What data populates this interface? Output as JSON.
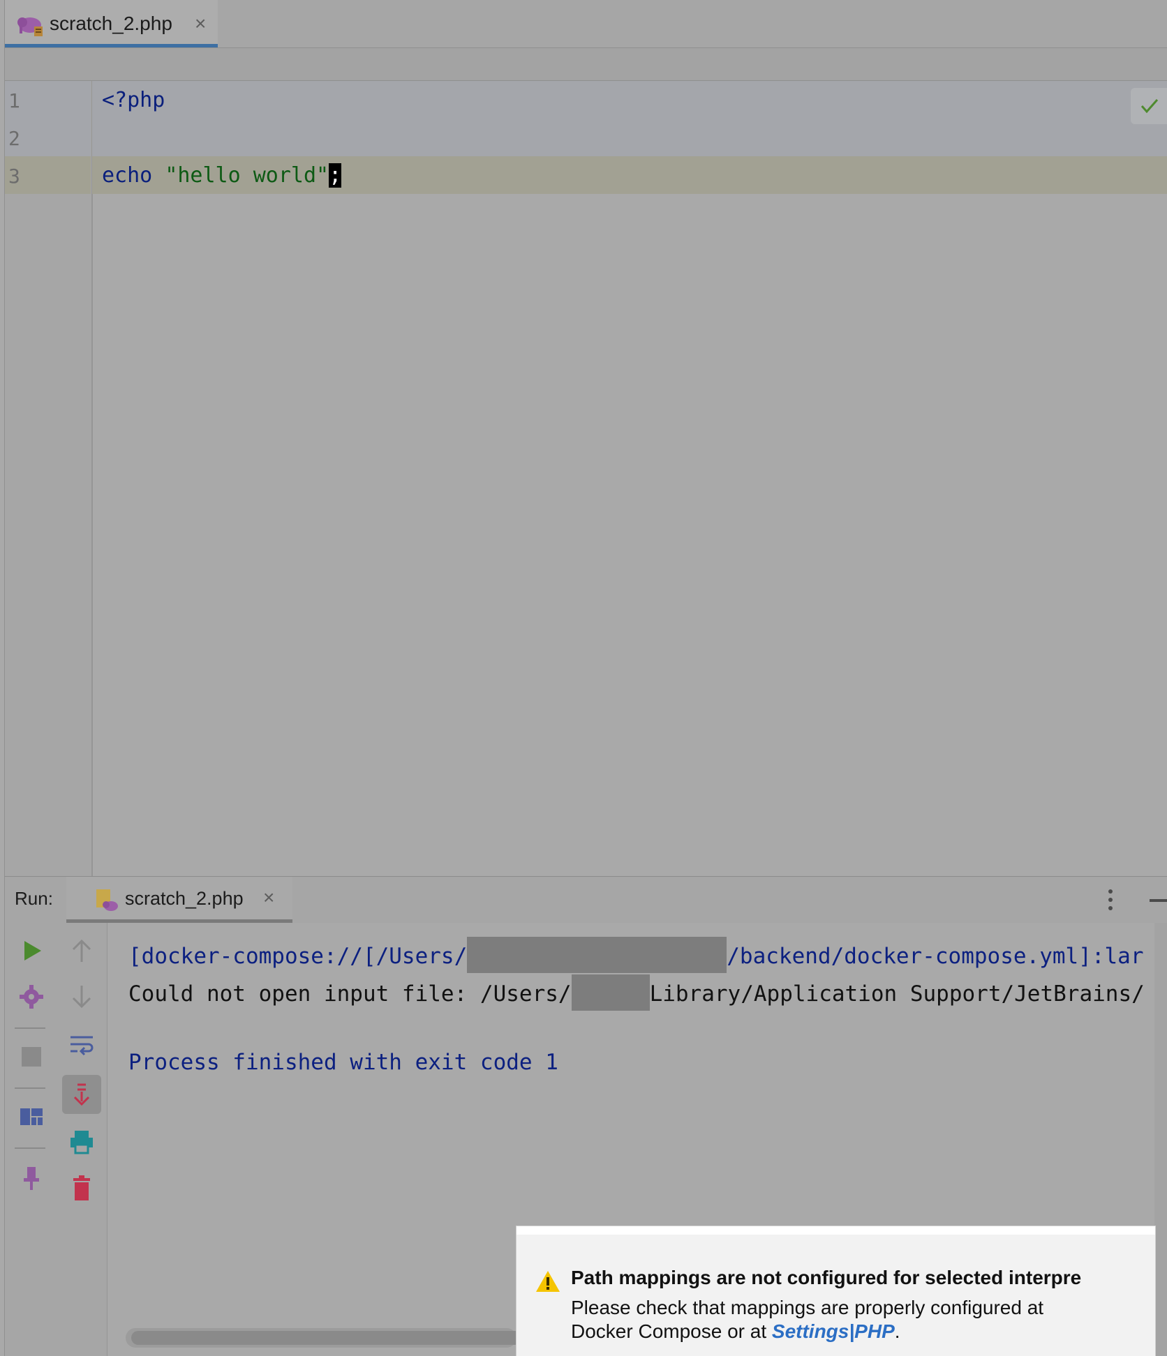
{
  "editor": {
    "tab": {
      "label": "scratch_2.php",
      "close": "×"
    },
    "line_numbers": [
      "1",
      "2",
      "3"
    ],
    "code": {
      "line1": "<?php",
      "line3_keyword": "echo ",
      "line3_string": "\"hello world\"",
      "line3_caret_char": ";"
    }
  },
  "run": {
    "label": "Run:",
    "tab": {
      "label": "scratch_2.php",
      "close": "×"
    },
    "console": {
      "line1_start": "[docker-compose://[/Users/",
      "line1_end": "/backend/docker-compose.yml]:lar",
      "line2_start": "Could not open input file: /Users/",
      "line2_end": "Library/Application Support/JetBrains/",
      "line4": "Process finished with exit code 1"
    }
  },
  "notification": {
    "title": "Path mappings are not configured for selected interpre",
    "body_line1": "Please check that mappings are properly configured at",
    "body_line2_prefix": "Docker Compose or at ",
    "link": "Settings|PHP",
    "body_suffix": "."
  },
  "colors": {
    "tab_underline": "#3d6fa3",
    "keyword": "#0a1f7c",
    "string": "#0d5a14",
    "link": "#2b6ec4",
    "warning": "#f5c400"
  }
}
